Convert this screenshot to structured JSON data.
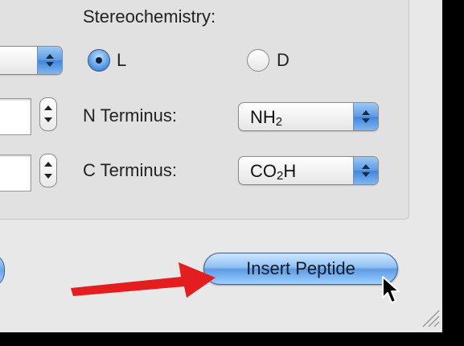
{
  "stereochemistry": {
    "label": "Stereochemistry:",
    "options": [
      {
        "label": "L",
        "selected": true
      },
      {
        "label": "D",
        "selected": false
      }
    ]
  },
  "n_terminus": {
    "label": "N Terminus:",
    "value_main": "NH",
    "value_sub": "2"
  },
  "c_terminus": {
    "label": "C Terminus:",
    "value_main": "CO",
    "value_sub": "2",
    "value_tail": "H"
  },
  "insert_button": {
    "label": "Insert Peptide"
  },
  "colors": {
    "annotation_arrow": "#e41e1e",
    "aqua_accent": "#5a9be6"
  },
  "icons": [
    "popup-arrows-icon",
    "stepper-icon",
    "annotation-arrow-icon",
    "mouse-cursor-icon",
    "resize-grip-icon"
  ]
}
